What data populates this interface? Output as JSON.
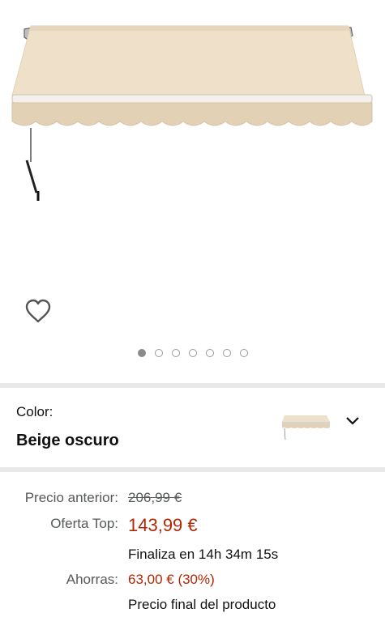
{
  "gallery": {
    "image_count": 7,
    "active_index": 0,
    "image_alt": "Toldo retráctil beige oscuro"
  },
  "variation": {
    "label": "Color:",
    "value": "Beige oscuro"
  },
  "pricing": {
    "previous_label": "Precio anterior:",
    "previous_value": "206,99 €",
    "deal_label": "Oferta Top:",
    "deal_value": "143,99 €",
    "countdown": "Finaliza en 14h 34m 15s",
    "savings_label": "Ahorras:",
    "savings_value": "63,00 € (30%)",
    "final_note": "Precio final del producto"
  },
  "colors": {
    "awning_fabric": "#eedfc7",
    "price_red": "#b12704",
    "muted_text": "#565959",
    "separator": "#e8e9ea"
  }
}
